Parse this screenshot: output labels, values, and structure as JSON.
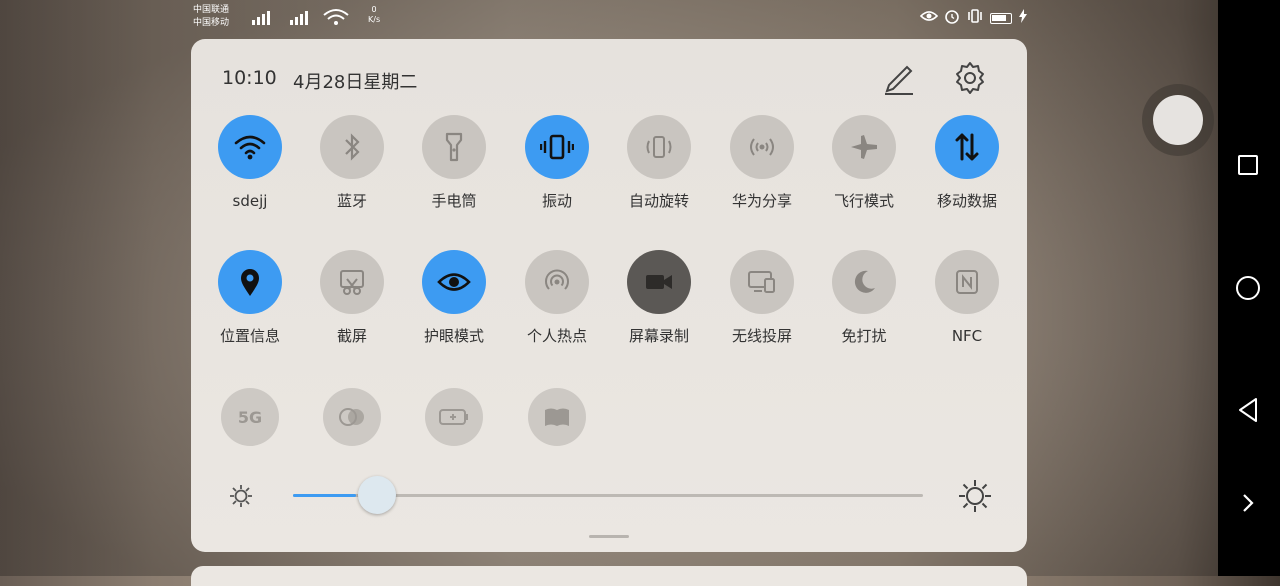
{
  "status_bar": {
    "carrier_line1": "中国联通",
    "carrier_line2": "中国移动",
    "net_speed_value": "0",
    "net_speed_unit": "K/s"
  },
  "header": {
    "time": "10:10",
    "date": "4月28日星期二"
  },
  "tiles_row1": [
    {
      "label": "sdejj",
      "icon": "wifi-icon",
      "active": true
    },
    {
      "label": "蓝牙",
      "icon": "bluetooth-icon",
      "active": false
    },
    {
      "label": "手电筒",
      "icon": "flashlight-icon",
      "active": false
    },
    {
      "label": "振动",
      "icon": "vibrate-icon",
      "active": true
    },
    {
      "label": "自动旋转",
      "icon": "rotate-icon",
      "active": false
    },
    {
      "label": "华为分享",
      "icon": "share-icon",
      "active": false
    },
    {
      "label": "飞行模式",
      "icon": "airplane-icon",
      "active": false
    },
    {
      "label": "移动数据",
      "icon": "mobile-data-icon",
      "active": true
    }
  ],
  "tiles_row2": [
    {
      "label": "位置信息",
      "icon": "location-icon",
      "active": true
    },
    {
      "label": "截屏",
      "icon": "screenshot-icon",
      "active": false
    },
    {
      "label": "护眼模式",
      "icon": "eye-icon",
      "active": true
    },
    {
      "label": "个人热点",
      "icon": "hotspot-icon",
      "active": false
    },
    {
      "label": "屏幕录制",
      "icon": "screen-record-icon",
      "active": false
    },
    {
      "label": "无线投屏",
      "icon": "cast-icon",
      "active": false
    },
    {
      "label": "免打扰",
      "icon": "moon-icon",
      "active": false
    },
    {
      "label": "NFC",
      "icon": "nfc-icon",
      "active": false
    }
  ],
  "tiles_row3": [
    {
      "icon_text": "5G",
      "icon": "5g-icon"
    },
    {
      "icon": "color-mode-icon"
    },
    {
      "icon": "battery-saver-icon"
    },
    {
      "icon": "ebook-icon"
    }
  ],
  "brightness": {
    "level": 0.1
  },
  "colors": {
    "accent": "#3d9bf2",
    "tile_off": "#c9c5c0",
    "panel": "#e8e4df"
  }
}
